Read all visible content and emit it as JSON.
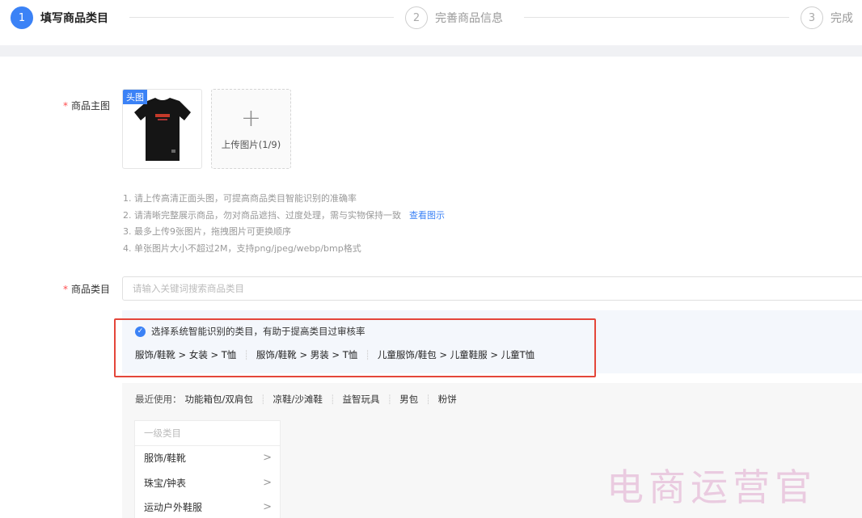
{
  "steps": [
    {
      "number": "1",
      "label": "填写商品类目",
      "state": "active"
    },
    {
      "number": "2",
      "label": "完善商品信息",
      "state": "inactive"
    },
    {
      "number": "3",
      "label": "完成",
      "state": "inactive"
    }
  ],
  "colors": {
    "accent": "#3b82f6",
    "required": "#ff4d4f",
    "highlight_border": "#e4463a"
  },
  "main_image": {
    "label": "商品主图",
    "thumb_tag": "头图",
    "upload_label": "上传图片(1/9)",
    "tips": [
      "1. 请上传高清正面头图，可提高商品类目智能识别的准确率",
      "2. 请清晰完整展示商品，勿对商品遮挡、过度处理，需与实物保持一致",
      "3. 最多上传9张图片，拖拽图片可更换顺序",
      "4. 单张图片大小不超过2M，支持png/jpeg/webp/bmp格式"
    ],
    "tip_link": "查看图示"
  },
  "category": {
    "label": "商品类目",
    "placeholder": "请输入关键词搜索商品类目",
    "suggest_text": "选择系统智能识别的类目，有助于提高类目过审核率",
    "suggestions": [
      "服饰/鞋靴 > 女装 > T恤",
      "服饰/鞋靴 > 男装 > T恤",
      "儿童服饰/鞋包 > 儿童鞋服 > 儿童T恤"
    ],
    "recent_label": "最近使用：",
    "recent": [
      "功能箱包/双肩包",
      "凉鞋/沙滩鞋",
      "益智玩具",
      "男包",
      "粉饼"
    ],
    "level1_header": "一级类目",
    "level1_items": [
      "服饰/鞋靴",
      "珠宝/钟表",
      "运动户外鞋服"
    ]
  },
  "icons": {
    "info": "info-icon",
    "plus": "plus-icon",
    "chevron": "chevron-right-icon"
  },
  "watermark": "电商运营官"
}
